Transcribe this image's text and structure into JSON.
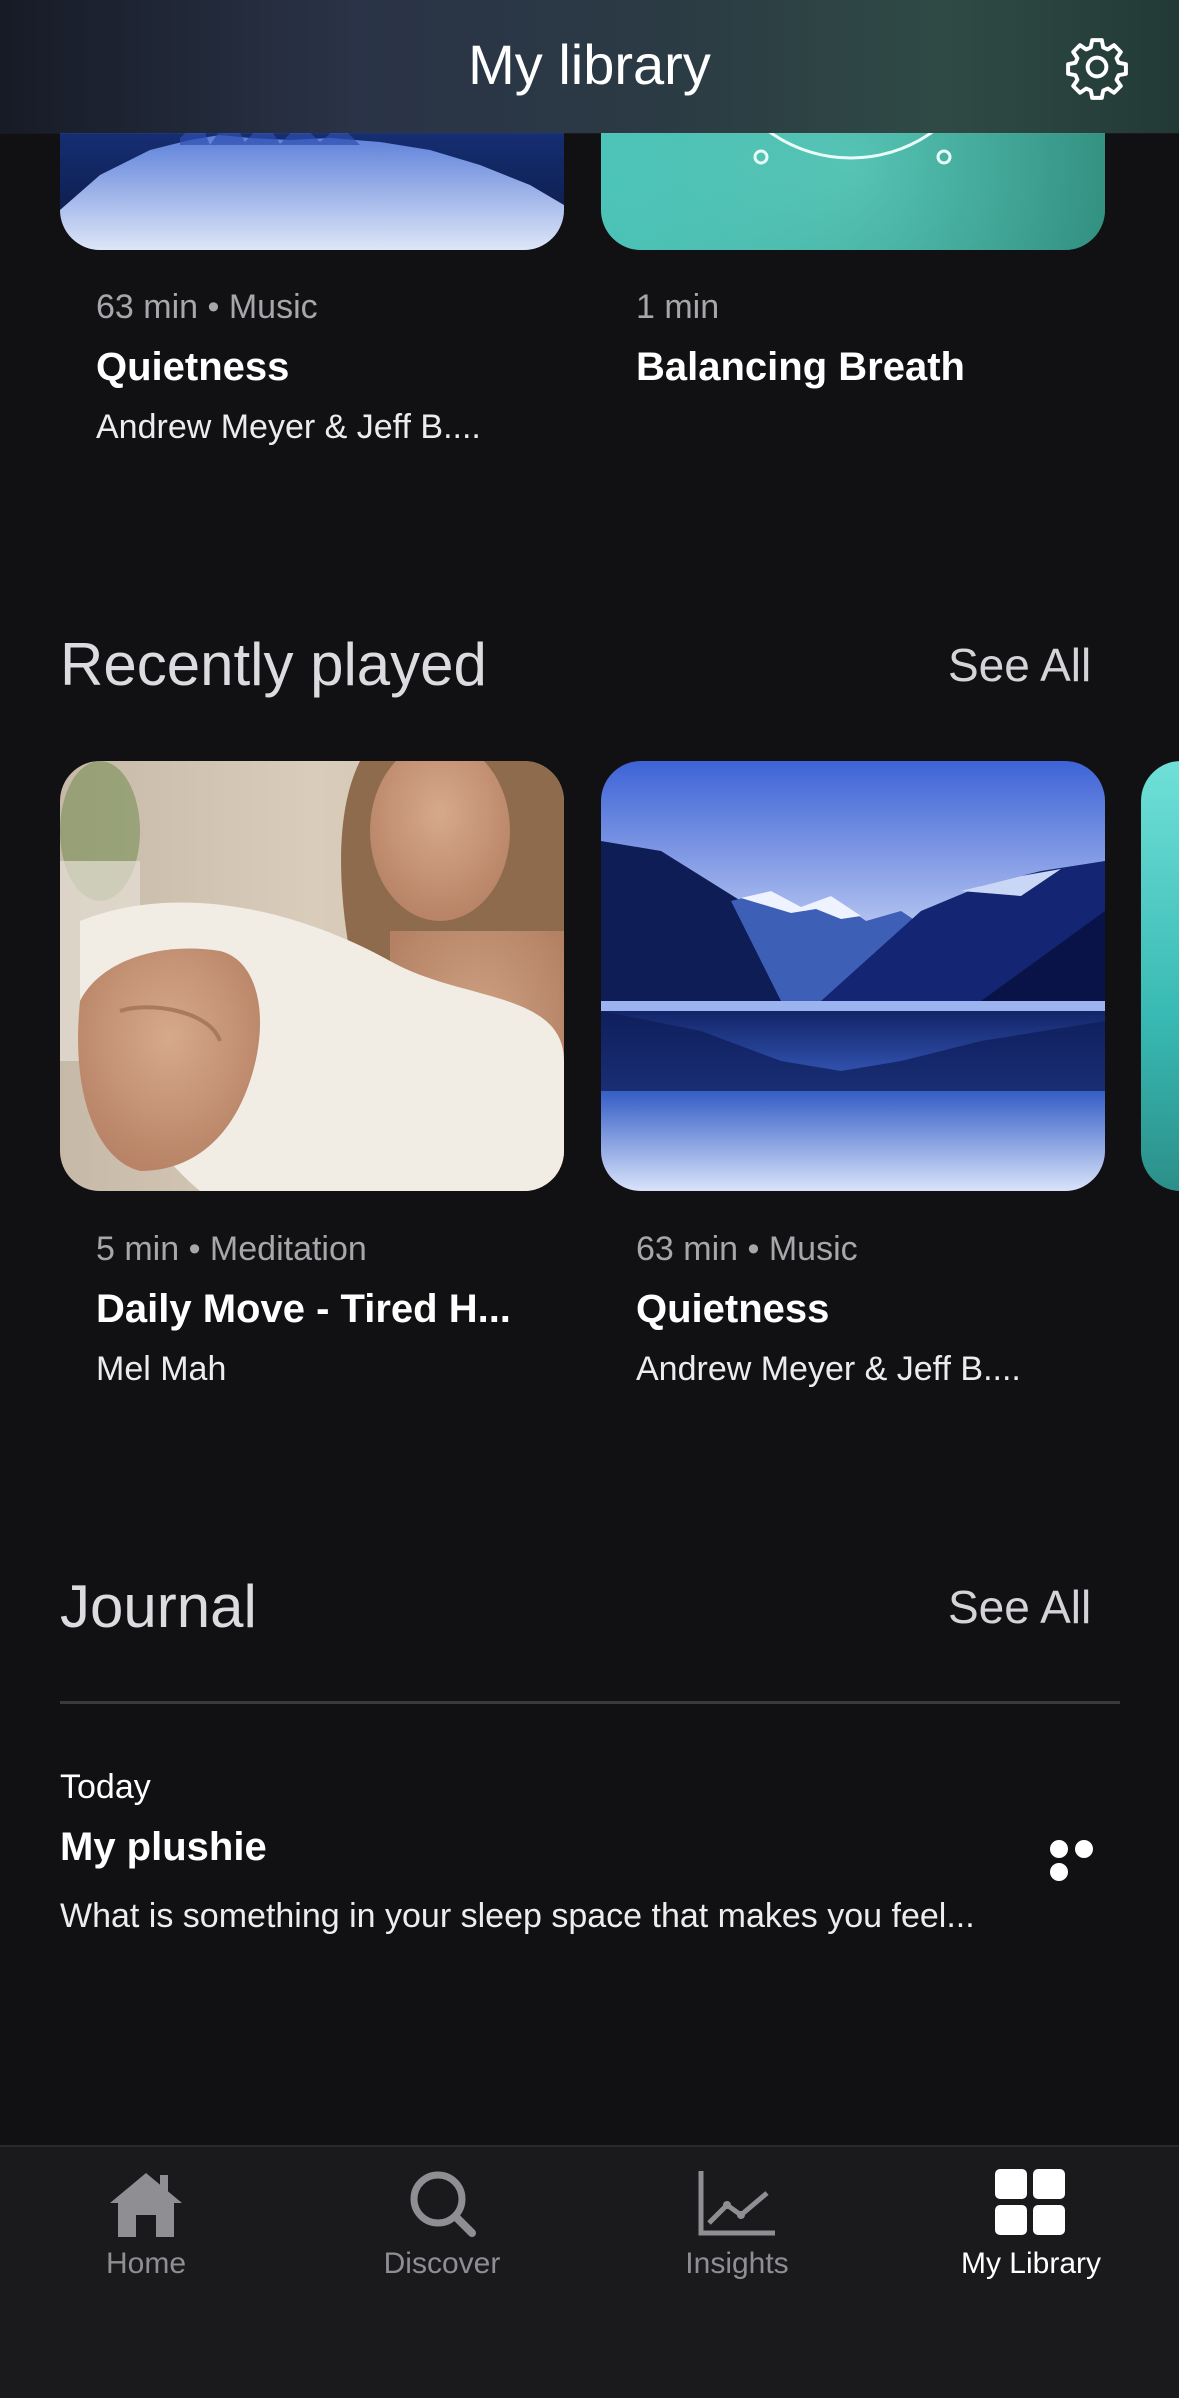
{
  "header": {
    "title": "My library"
  },
  "top_cards": [
    {
      "meta": "63 min • Music",
      "title": "Quietness",
      "artist": "Andrew Meyer & Jeff B...."
    },
    {
      "meta": "1 min",
      "title": "Balancing Breath"
    }
  ],
  "recently_played": {
    "title": "Recently played",
    "see_all": "See All",
    "items": [
      {
        "meta": "5 min • Meditation",
        "title": "Daily Move - Tired H...",
        "artist": "Mel Mah"
      },
      {
        "meta": "63 min • Music",
        "title": "Quietness",
        "artist": "Andrew Meyer & Jeff B...."
      }
    ]
  },
  "journal": {
    "title": "Journal",
    "see_all": "See All",
    "entry": {
      "date": "Today",
      "title": "My plushie",
      "text": "What is something in your sleep space that makes you feel..."
    }
  },
  "tabs": [
    {
      "label": "Home",
      "icon": "home-icon",
      "active": false
    },
    {
      "label": "Discover",
      "icon": "search-icon",
      "active": false
    },
    {
      "label": "Insights",
      "icon": "chart-icon",
      "active": false
    },
    {
      "label": "My Library",
      "icon": "grid-icon",
      "active": true
    }
  ],
  "colors": {
    "background": "#111113",
    "accent_text": "#ffffff",
    "muted_text": "#a7a7ab",
    "tab_inactive": "#8e8e93"
  }
}
